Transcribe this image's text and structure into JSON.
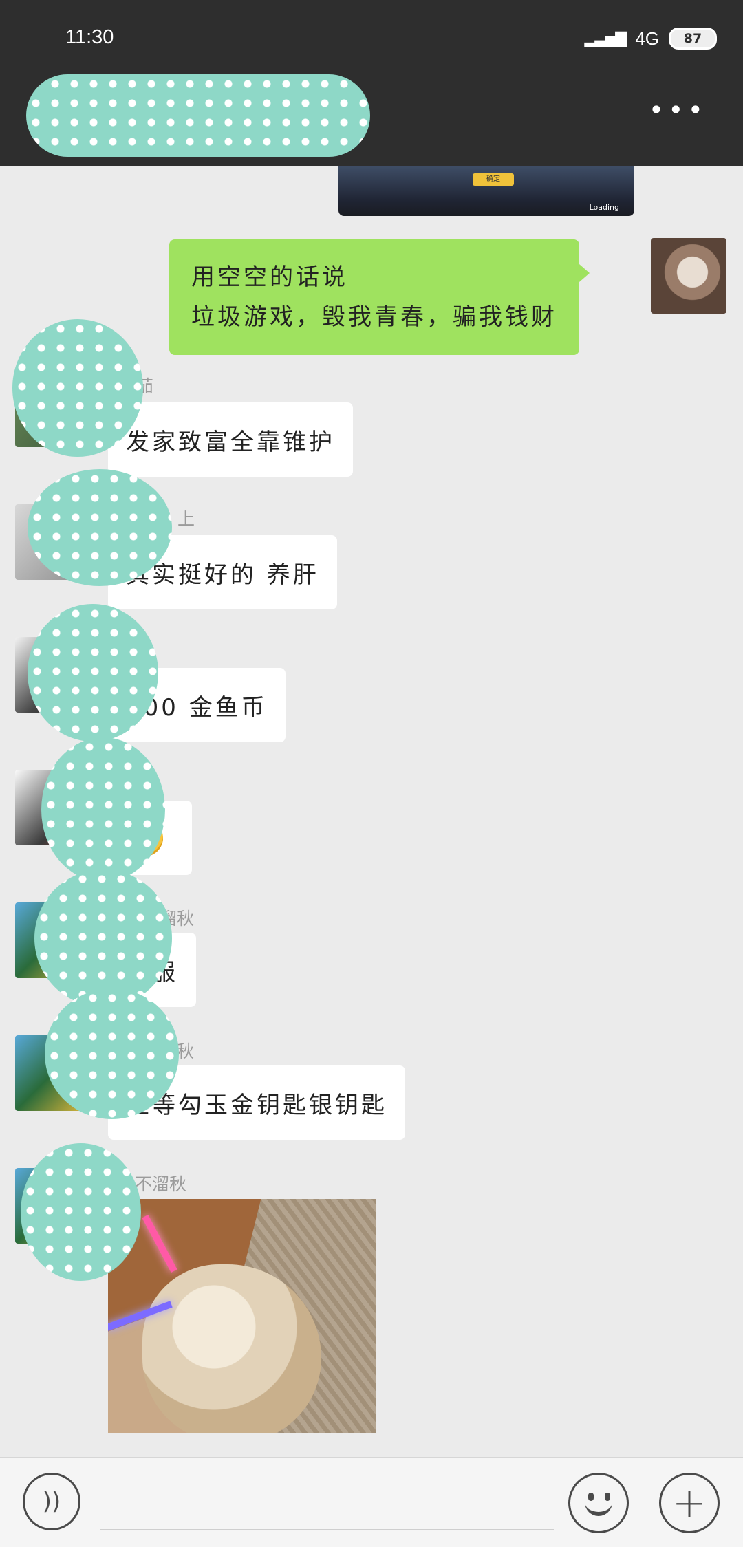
{
  "status_bar": {
    "time": "11:30",
    "network": "4G",
    "battery": "87"
  },
  "header": {
    "more_icon": "more-icon",
    "more_label": "•••"
  },
  "messages": [
    {
      "side": "self",
      "lines": [
        "用空空的话说",
        "垃圾游戏，毁我青春，骗我钱财"
      ]
    },
    {
      "side": "other",
      "nickname": "茄",
      "text": "发家致富全靠锥护"
    },
    {
      "side": "other",
      "nickname": "上",
      "text": "其实挺好的  养肝"
    },
    {
      "side": "other",
      "nickname": "",
      "text": "100 金鱼币"
    },
    {
      "side": "other",
      "nickname": "",
      "emoji": "smirk-emoji"
    },
    {
      "side": "other",
      "nickname": "溜秋",
      "text": "舒服"
    },
    {
      "side": "other",
      "nickname": "溜秋",
      "text": "坐等勾玉金钥匙银钥匙"
    },
    {
      "side": "other",
      "nickname": "不溜秋",
      "image": "cat-with-lightsabers-image"
    }
  ],
  "top_image": {
    "button_label": "确定",
    "loading_label": "Loading"
  },
  "input_bar": {
    "voice_icon": "voice-icon",
    "emoji_icon": "emoji-icon",
    "plus_icon": "plus-icon",
    "voice_glyph": "))",
    "plus_glyph": "+"
  }
}
